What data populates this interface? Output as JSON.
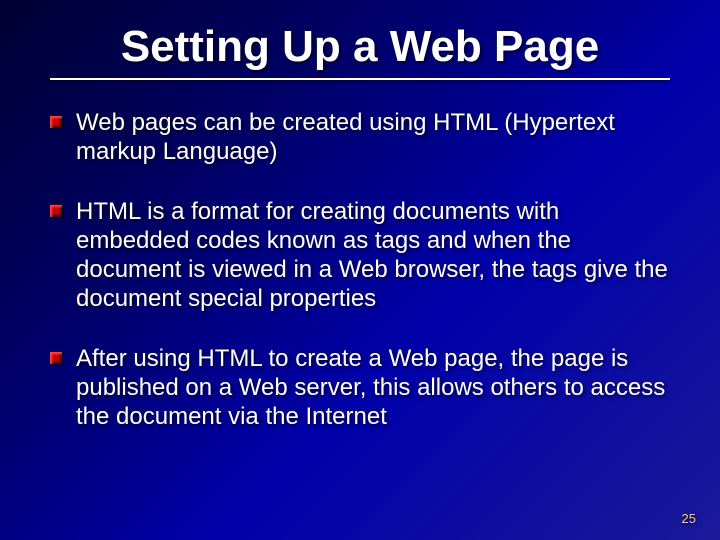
{
  "slide": {
    "title": "Setting Up a Web Page",
    "bullets": [
      "Web pages can be created using HTML (Hypertext markup Language)",
      "HTML is a format for creating documents with embedded codes known as tags and when the document is viewed in a Web browser, the tags give the document special properties",
      "After using HTML to create a Web page, the page is published on a Web server, this allows others to access the document via the Internet"
    ],
    "pageNumber": "25"
  }
}
